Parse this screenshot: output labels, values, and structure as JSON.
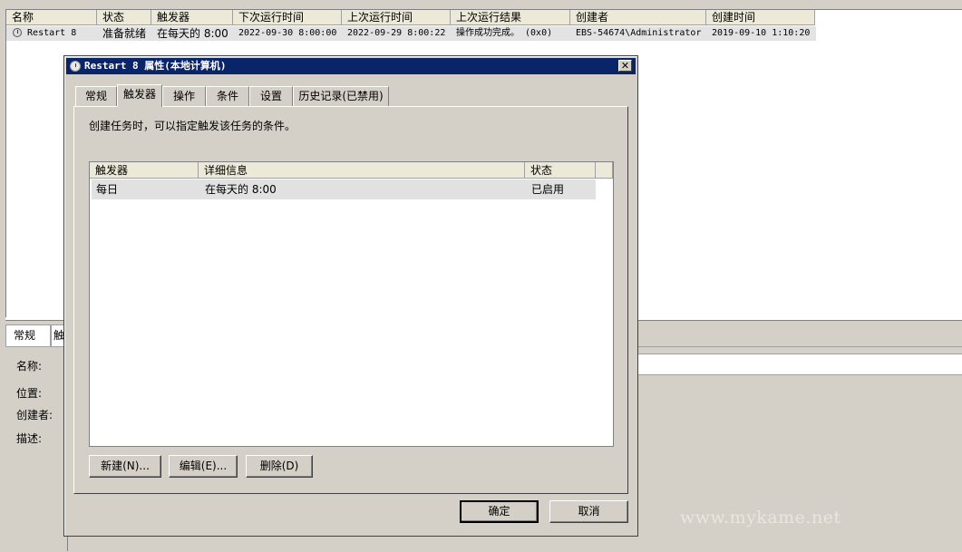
{
  "background": {
    "columns": [
      "名称",
      "状态",
      "触发器",
      "下次运行时间",
      "上次运行时间",
      "上次运行结果",
      "创建者",
      "创建时间"
    ],
    "task_row": {
      "name": "Restart 8",
      "status": "准备就绪",
      "trigger": "在每天的 8:00",
      "next_run": "2022-09-30 8:00:00",
      "last_run": "2022-09-29 8:00:22",
      "last_result": "操作成功完成。 (0x0)",
      "creator": "EBS-54674\\Administrator",
      "created": "2019-09-10 1:10:20"
    },
    "details_tabs": [
      "常规",
      "触"
    ],
    "details_labels": [
      "名称:",
      "位置:",
      "创建者:",
      "描述:"
    ]
  },
  "dialog": {
    "title": "Restart 8 属性(本地计算机)",
    "close_glyph": "✕",
    "tabs": [
      "常规",
      "触发器",
      "操作",
      "条件",
      "设置",
      "历史记录(已禁用)"
    ],
    "active_tab": "触发器",
    "description": "创建任务时，可以指定触发该任务的条件。",
    "grid": {
      "headers": [
        "触发器",
        "详细信息",
        "状态"
      ],
      "rows": [
        {
          "trigger": "每日",
          "details": "在每天的 8:00",
          "status": "已启用"
        }
      ]
    },
    "buttons": {
      "new": "新建(N)...",
      "edit": "编辑(E)...",
      "delete": "删除(D)",
      "ok": "确定",
      "cancel": "取消"
    }
  },
  "watermark": "www.mykame.net",
  "icons": {
    "task": "clock-icon",
    "close": "close-icon"
  }
}
